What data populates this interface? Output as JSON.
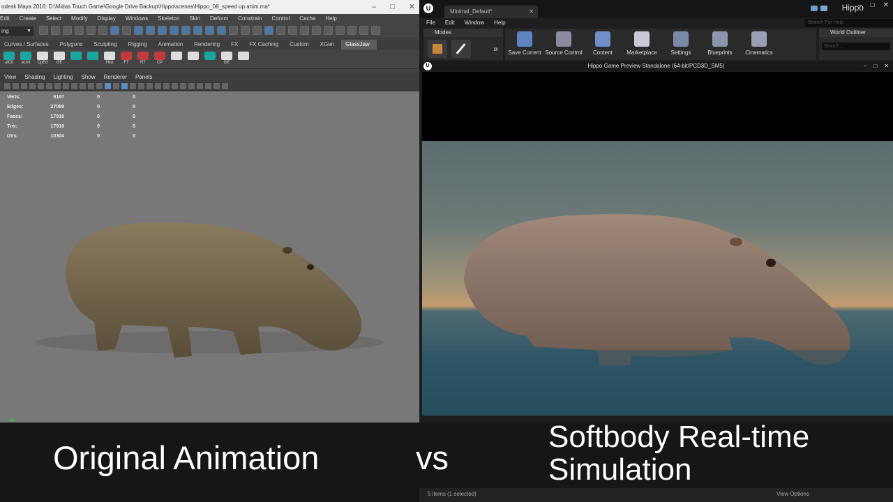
{
  "maya": {
    "title": "odesk Maya 2016: D:\\Midas Touch Game\\Google Drive Backup\\Hippo\\scenes\\Hippo_08_speed up anim.ma*",
    "menu": [
      "Edit",
      "Create",
      "Select",
      "Modify",
      "Display",
      "Windows",
      "Skeleton",
      "Skin",
      "Deform",
      "Constrain",
      "Control",
      "Cache",
      "Help"
    ],
    "mode": "ing",
    "shelf_tabs": [
      "Curves / Surfaces",
      "Polygons",
      "Sculpting",
      "Rigging",
      "Animation",
      "Rendering",
      "FX",
      "FX Caching",
      "Custom",
      "XGen",
      "GlassJaw"
    ],
    "active_shelf_tab": "GlassJaw",
    "shelf_labels": [
      "alCtl",
      "aUnt",
      "CpEd",
      "GE",
      "",
      "",
      "Hist",
      "FT",
      "RT",
      "CP",
      "",
      "",
      "",
      "GE",
      ""
    ],
    "viewport_menu": [
      "View",
      "Shading",
      "Lighting",
      "Show",
      "Renderer",
      "Panels"
    ],
    "hud": [
      {
        "label": "Verts:",
        "value": "9197",
        "a": "0",
        "b": "0"
      },
      {
        "label": "Edges:",
        "value": "27089",
        "a": "0",
        "b": "0"
      },
      {
        "label": "Faces:",
        "value": "17916",
        "a": "0",
        "b": "0"
      },
      {
        "label": "Tris:",
        "value": "17916",
        "a": "0",
        "b": "0"
      },
      {
        "label": "UVs:",
        "value": "10304",
        "a": "0",
        "b": "0"
      }
    ]
  },
  "ue": {
    "tab": "Minimal_Default*",
    "user": "Hippo",
    "menu": [
      "File",
      "Edit",
      "Window",
      "Help"
    ],
    "search_help": "Search For Help",
    "modes": "Modes",
    "toolbar": [
      {
        "label": "Save Current",
        "color": "#5d84c0"
      },
      {
        "label": "Source Control",
        "color": "#8a8aa0"
      },
      {
        "label": "Content",
        "color": "#6f8fc8"
      },
      {
        "label": "Marketplace",
        "color": "#c9c9d6"
      },
      {
        "label": "Settings",
        "color": "#7a8aa6"
      },
      {
        "label": "Blueprints",
        "color": "#8a96b0"
      },
      {
        "label": "Cinematics",
        "color": "#9aa0b4"
      }
    ],
    "outliner": "World Outliner",
    "outliner_search": "Search...",
    "preview_title": "Hippo Game Preview Standalone (64-bit/PCD3D_SM5)",
    "status_left": "5 items (1 selected)",
    "status_right": "View Options"
  },
  "captions": {
    "left": "Original Animation",
    "vs": "vs",
    "right": "Softbody Real-time Simulation"
  }
}
